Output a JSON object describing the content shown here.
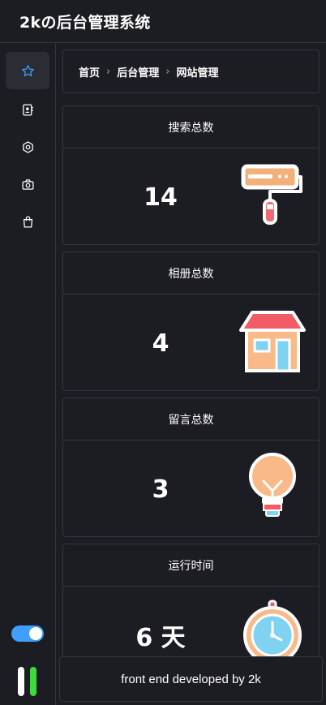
{
  "header": {
    "title": "2kの后台管理系统"
  },
  "sidebar": {
    "items": [
      {
        "icon": "star-icon",
        "active": true
      },
      {
        "icon": "contacts-icon",
        "active": false
      },
      {
        "icon": "settings-gear-icon",
        "active": false
      },
      {
        "icon": "camera-icon",
        "active": false
      },
      {
        "icon": "shopping-bag-icon",
        "active": false
      }
    ],
    "theme_toggle_on": true
  },
  "breadcrumb": {
    "items": [
      "首页",
      "后台管理",
      "网站管理"
    ]
  },
  "cards": [
    {
      "title": "搜索总数",
      "value": "14",
      "illustration": "paint-roller-icon"
    },
    {
      "title": "相册总数",
      "value": "4",
      "illustration": "house-icon"
    },
    {
      "title": "留言总数",
      "value": "3",
      "illustration": "lightbulb-icon"
    },
    {
      "title": "运行时间",
      "value": "6 天",
      "illustration": "stopwatch-icon"
    }
  ],
  "footer": {
    "text": "front end developed by 2k"
  },
  "colors": {
    "background": "#1c1d23",
    "border": "#34363e",
    "accent": "#409eff",
    "active_nav": "#2b2d34",
    "pause_green": "#3ddc3d"
  }
}
